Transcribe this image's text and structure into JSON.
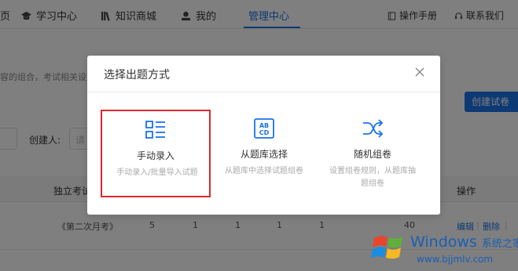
{
  "nav": {
    "partial_item": "页",
    "items": [
      "学习中心",
      "知识商城",
      "我的",
      "管理中心"
    ],
    "manual": "操作手册",
    "contact": "联系我们"
  },
  "page": {
    "hint": "容的组合，考试相关设置",
    "create_button": "创建试卷",
    "creator_label": "创建人:",
    "creator_placeholder": "请",
    "columns": [
      "独立考试",
      "操作"
    ],
    "row": {
      "name": "《第二次月考》",
      "values": [
        "5",
        "1",
        "1",
        "1",
        "1",
        "40"
      ],
      "edit": "编辑",
      "delete": "删除"
    }
  },
  "modal": {
    "title": "选择出题方式",
    "options": [
      {
        "title": "手动录入",
        "desc": "手动录入/批量导入试题",
        "icon": "list-icon"
      },
      {
        "title": "从题库选择",
        "desc": "从题库中选择试题组卷",
        "icon": "abcd-icon"
      },
      {
        "title": "随机组卷",
        "desc": "设置组卷规则，从题库抽题组卷",
        "icon": "shuffle-icon"
      }
    ]
  },
  "watermark": {
    "brand": "Windows",
    "brand_cn": "系统之家",
    "url": "www.bjjmlv.com"
  },
  "colors": {
    "accent": "#1a73e8",
    "selection": "#d9282f",
    "overlay": "rgba(0,0,0,0.5)"
  }
}
